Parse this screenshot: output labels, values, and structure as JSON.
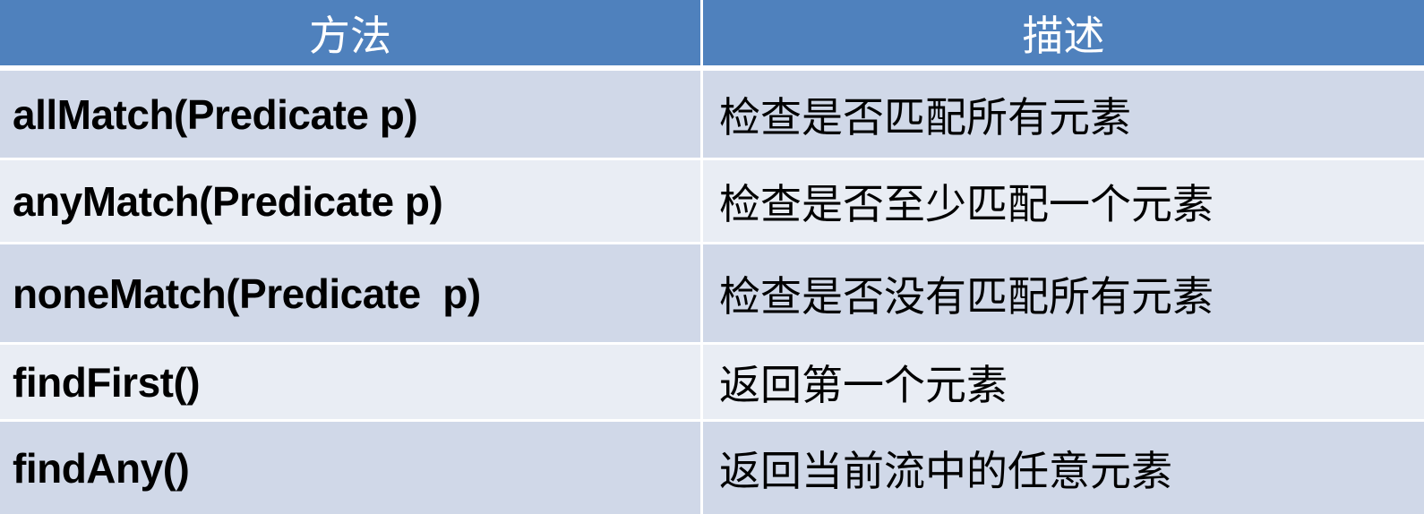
{
  "header": {
    "method": "方法",
    "description": "描述"
  },
  "rows": [
    {
      "method": "allMatch(Predicate p)",
      "description": "检查是否匹配所有元素"
    },
    {
      "method": "anyMatch(Predicate p)",
      "description": "检查是否至少匹配一个元素"
    },
    {
      "method": "noneMatch(Predicate  p)",
      "description": "检查是否没有匹配所有元素"
    },
    {
      "method": "findFirst()",
      "description": "返回第一个元素"
    },
    {
      "method": "findAny()",
      "description": "返回当前流中的任意元素"
    }
  ],
  "colors": {
    "header_bg": "#4f81bd",
    "row_odd_bg": "#d0d8e8",
    "row_even_bg": "#e9edf4"
  }
}
